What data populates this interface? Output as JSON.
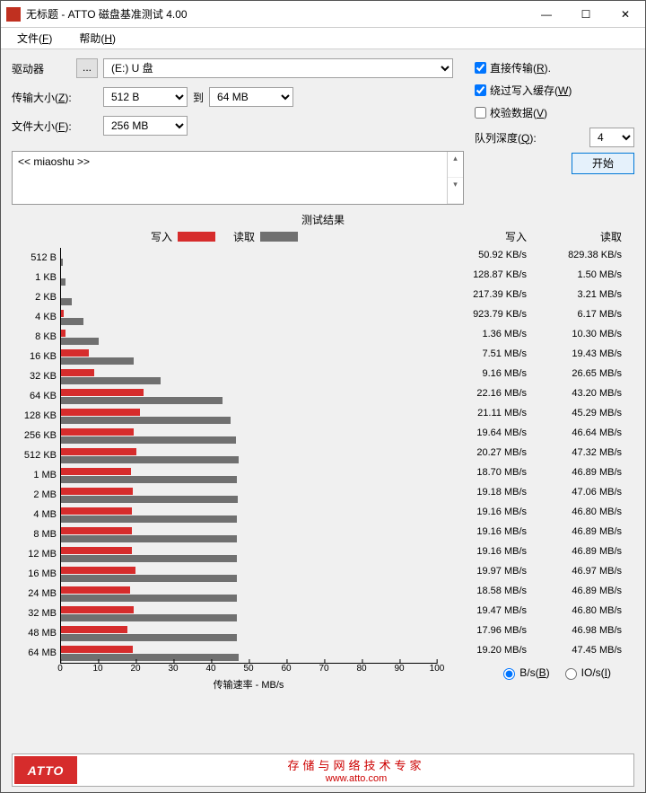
{
  "window": {
    "title": "无标题 - ATTO 磁盘基准测试 4.00"
  },
  "menu": {
    "file": "文件(F)",
    "help": "帮助(H)"
  },
  "labels": {
    "drive": "驱动器",
    "drive_btn": "...",
    "transfer_size": "传输大小(Z):",
    "to": "到",
    "file_size": "文件大小(F):",
    "direct_io": "直接传输(R).",
    "bypass_cache": "绕过写入缓存(W)",
    "verify": "校验数据(V)",
    "queue_depth": "队列深度(Q):",
    "start": "开始",
    "description": "<< miaoshu >>",
    "results_title": "测试结果",
    "legend_write": "写入",
    "legend_read": "读取",
    "xaxis": "传输速率 - MB/s",
    "col_write": "写入",
    "col_read": "读取",
    "radio_bs": "B/s(B)",
    "radio_ios": "IO/s(I)",
    "footer_cn": "存储与网络技术专家",
    "footer_url": "www.atto.com",
    "atto": "ATTO"
  },
  "values": {
    "drive": "(E:) U 盘",
    "ts_from": "512 B",
    "ts_to": "64 MB",
    "file_size": "256 MB",
    "queue_depth": "4",
    "direct_io": true,
    "bypass_cache": true,
    "verify": false
  },
  "chart_data": {
    "type": "bar",
    "xlim": [
      0,
      100
    ],
    "xticks": [
      0,
      10,
      20,
      30,
      40,
      50,
      60,
      70,
      80,
      90,
      100
    ],
    "xlabel": "传输速率 - MB/s",
    "series_names": [
      "写入",
      "读取"
    ],
    "rows": [
      {
        "size": "512 B",
        "write": {
          "v": 50.92,
          "u": "KB/s",
          "mb": 0.05
        },
        "read": {
          "v": 829.38,
          "u": "KB/s",
          "mb": 0.83
        }
      },
      {
        "size": "1 KB",
        "write": {
          "v": 128.87,
          "u": "KB/s",
          "mb": 0.13
        },
        "read": {
          "v": 1.5,
          "u": "MB/s",
          "mb": 1.5
        }
      },
      {
        "size": "2 KB",
        "write": {
          "v": 217.39,
          "u": "KB/s",
          "mb": 0.22
        },
        "read": {
          "v": 3.21,
          "u": "MB/s",
          "mb": 3.21
        }
      },
      {
        "size": "4 KB",
        "write": {
          "v": 923.79,
          "u": "KB/s",
          "mb": 0.92
        },
        "read": {
          "v": 6.17,
          "u": "MB/s",
          "mb": 6.17
        }
      },
      {
        "size": "8 KB",
        "write": {
          "v": 1.36,
          "u": "MB/s",
          "mb": 1.36
        },
        "read": {
          "v": 10.3,
          "u": "MB/s",
          "mb": 10.3
        }
      },
      {
        "size": "16 KB",
        "write": {
          "v": 7.51,
          "u": "MB/s",
          "mb": 7.51
        },
        "read": {
          "v": 19.43,
          "u": "MB/s",
          "mb": 19.43
        }
      },
      {
        "size": "32 KB",
        "write": {
          "v": 9.16,
          "u": "MB/s",
          "mb": 9.16
        },
        "read": {
          "v": 26.65,
          "u": "MB/s",
          "mb": 26.65
        }
      },
      {
        "size": "64 KB",
        "write": {
          "v": 22.16,
          "u": "MB/s",
          "mb": 22.16
        },
        "read": {
          "v": 43.2,
          "u": "MB/s",
          "mb": 43.2
        }
      },
      {
        "size": "128 KB",
        "write": {
          "v": 21.11,
          "u": "MB/s",
          "mb": 21.11
        },
        "read": {
          "v": 45.29,
          "u": "MB/s",
          "mb": 45.29
        }
      },
      {
        "size": "256 KB",
        "write": {
          "v": 19.64,
          "u": "MB/s",
          "mb": 19.64
        },
        "read": {
          "v": 46.64,
          "u": "MB/s",
          "mb": 46.64
        }
      },
      {
        "size": "512 KB",
        "write": {
          "v": 20.27,
          "u": "MB/s",
          "mb": 20.27
        },
        "read": {
          "v": 47.32,
          "u": "MB/s",
          "mb": 47.32
        }
      },
      {
        "size": "1 MB",
        "write": {
          "v": 18.7,
          "u": "MB/s",
          "mb": 18.7
        },
        "read": {
          "v": 46.89,
          "u": "MB/s",
          "mb": 46.89
        }
      },
      {
        "size": "2 MB",
        "write": {
          "v": 19.18,
          "u": "MB/s",
          "mb": 19.18
        },
        "read": {
          "v": 47.06,
          "u": "MB/s",
          "mb": 47.06
        }
      },
      {
        "size": "4 MB",
        "write": {
          "v": 19.16,
          "u": "MB/s",
          "mb": 19.16
        },
        "read": {
          "v": 46.8,
          "u": "MB/s",
          "mb": 46.8
        }
      },
      {
        "size": "8 MB",
        "write": {
          "v": 19.16,
          "u": "MB/s",
          "mb": 19.16
        },
        "read": {
          "v": 46.89,
          "u": "MB/s",
          "mb": 46.89
        }
      },
      {
        "size": "12 MB",
        "write": {
          "v": 19.16,
          "u": "MB/s",
          "mb": 19.16
        },
        "read": {
          "v": 46.89,
          "u": "MB/s",
          "mb": 46.89
        }
      },
      {
        "size": "16 MB",
        "write": {
          "v": 19.97,
          "u": "MB/s",
          "mb": 19.97
        },
        "read": {
          "v": 46.97,
          "u": "MB/s",
          "mb": 46.97
        }
      },
      {
        "size": "24 MB",
        "write": {
          "v": 18.58,
          "u": "MB/s",
          "mb": 18.58
        },
        "read": {
          "v": 46.89,
          "u": "MB/s",
          "mb": 46.89
        }
      },
      {
        "size": "32 MB",
        "write": {
          "v": 19.47,
          "u": "MB/s",
          "mb": 19.47
        },
        "read": {
          "v": 46.8,
          "u": "MB/s",
          "mb": 46.8
        }
      },
      {
        "size": "48 MB",
        "write": {
          "v": 17.96,
          "u": "MB/s",
          "mb": 17.96
        },
        "read": {
          "v": 46.98,
          "u": "MB/s",
          "mb": 46.98
        }
      },
      {
        "size": "64 MB",
        "write": {
          "v": 19.2,
          "u": "MB/s",
          "mb": 19.2
        },
        "read": {
          "v": 47.45,
          "u": "MB/s",
          "mb": 47.45
        }
      }
    ]
  }
}
